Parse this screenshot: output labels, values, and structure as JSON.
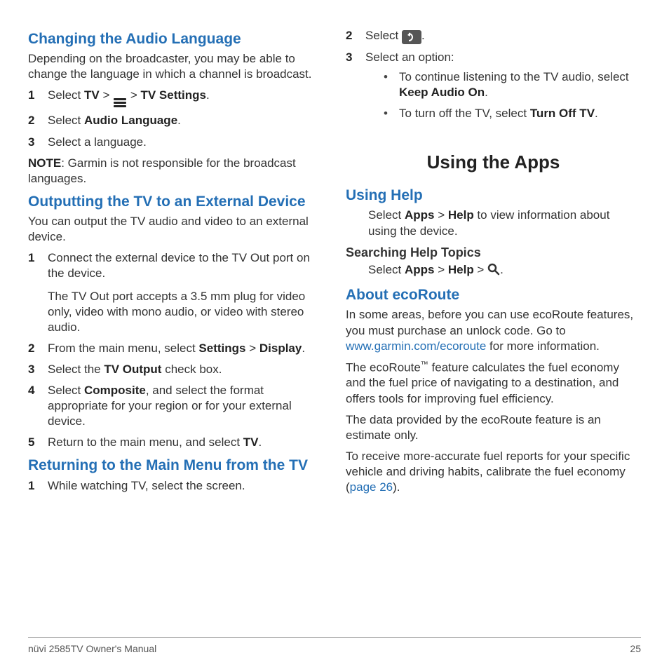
{
  "footer": {
    "left": "nüvi 2585TV Owner's Manual",
    "right": "25"
  },
  "left": {
    "h_audio": "Changing the Audio Language",
    "p_audio": "Depending on the broadcaster, you may be able to change the language in which a channel is broadcast.",
    "s1n": "1",
    "s1a": "Select ",
    "s1b": "TV",
    "s1c": " > ",
    "s1d": " > ",
    "s1e": "TV Settings",
    "s1f": ".",
    "s2n": "2",
    "s2a": "Select ",
    "s2b": "Audio Language",
    "s2c": ".",
    "s3n": "3",
    "s3a": "Select a language.",
    "note_label": "NOTE",
    "note_body": ": Garmin is not responsible for the broadcast languages.",
    "h_out": "Outputting the TV to an External Device",
    "p_out": "You can output the TV audio and video to an external device.",
    "o1n": "1",
    "o1a": "Connect the external device to the TV Out port on the device.",
    "o1b": "The TV Out port accepts a 3.5 mm plug for video only, video with mono audio, or video with stereo audio.",
    "o2n": "2",
    "o2a": "From the main menu, select ",
    "o2b": "Settings",
    "o2c": " > ",
    "o2d": "Display",
    "o2e": ".",
    "o3n": "3",
    "o3a": "Select the ",
    "o3b": "TV Output",
    "o3c": " check box.",
    "o4n": "4",
    "o4a": "Select ",
    "o4b": "Composite",
    "o4c": ", and select the format appropriate for your region or for your external device.",
    "o5n": "5",
    "o5a": "Return to the main menu, and select ",
    "o5b": "TV",
    "o5c": ".",
    "h_ret": "Returning to the Main Menu from the TV",
    "r1n": "1",
    "r1a": "While watching TV, select the screen."
  },
  "right": {
    "r2n": "2",
    "r2a": "Select ",
    "r2b": ".",
    "r3n": "3",
    "r3a": "Select an option:",
    "b1a": "To continue listening to the TV audio, select ",
    "b1b": "Keep Audio On",
    "b1c": ".",
    "b2a": "To turn off the TV, select ",
    "b2b": "Turn Off TV",
    "b2c": ".",
    "h_apps": "Using the Apps",
    "h_help": "Using Help",
    "p_help_a": "Select ",
    "p_help_b": "Apps",
    "p_help_c": " > ",
    "p_help_d": "Help",
    "p_help_e": " to view information about using the device.",
    "h_search": "Searching Help Topics",
    "p_search_a": "Select ",
    "p_search_b": "Apps",
    "p_search_c": " > ",
    "p_search_d": "Help",
    "p_search_e": " > ",
    "p_search_f": ".",
    "h_eco": "About ecoRoute",
    "p_eco1_a": "In some areas, before you can use ecoRoute features, you must purchase an unlock code. Go to ",
    "p_eco1_link": "www.garmin.com/ecoroute",
    "p_eco1_b": " for more information.",
    "p_eco2_a": "The ecoRoute",
    "p_eco2_tm": "™",
    "p_eco2_b": " feature calculates the fuel economy and the fuel price of navigating to a destination, and offers tools for improving fuel efficiency.",
    "p_eco3": "The data provided by the ecoRoute feature is an estimate only.",
    "p_eco4_a": "To receive more-accurate fuel reports for your specific vehicle and driving habits, calibrate the fuel economy (",
    "p_eco4_link": "page 26",
    "p_eco4_b": ")."
  }
}
